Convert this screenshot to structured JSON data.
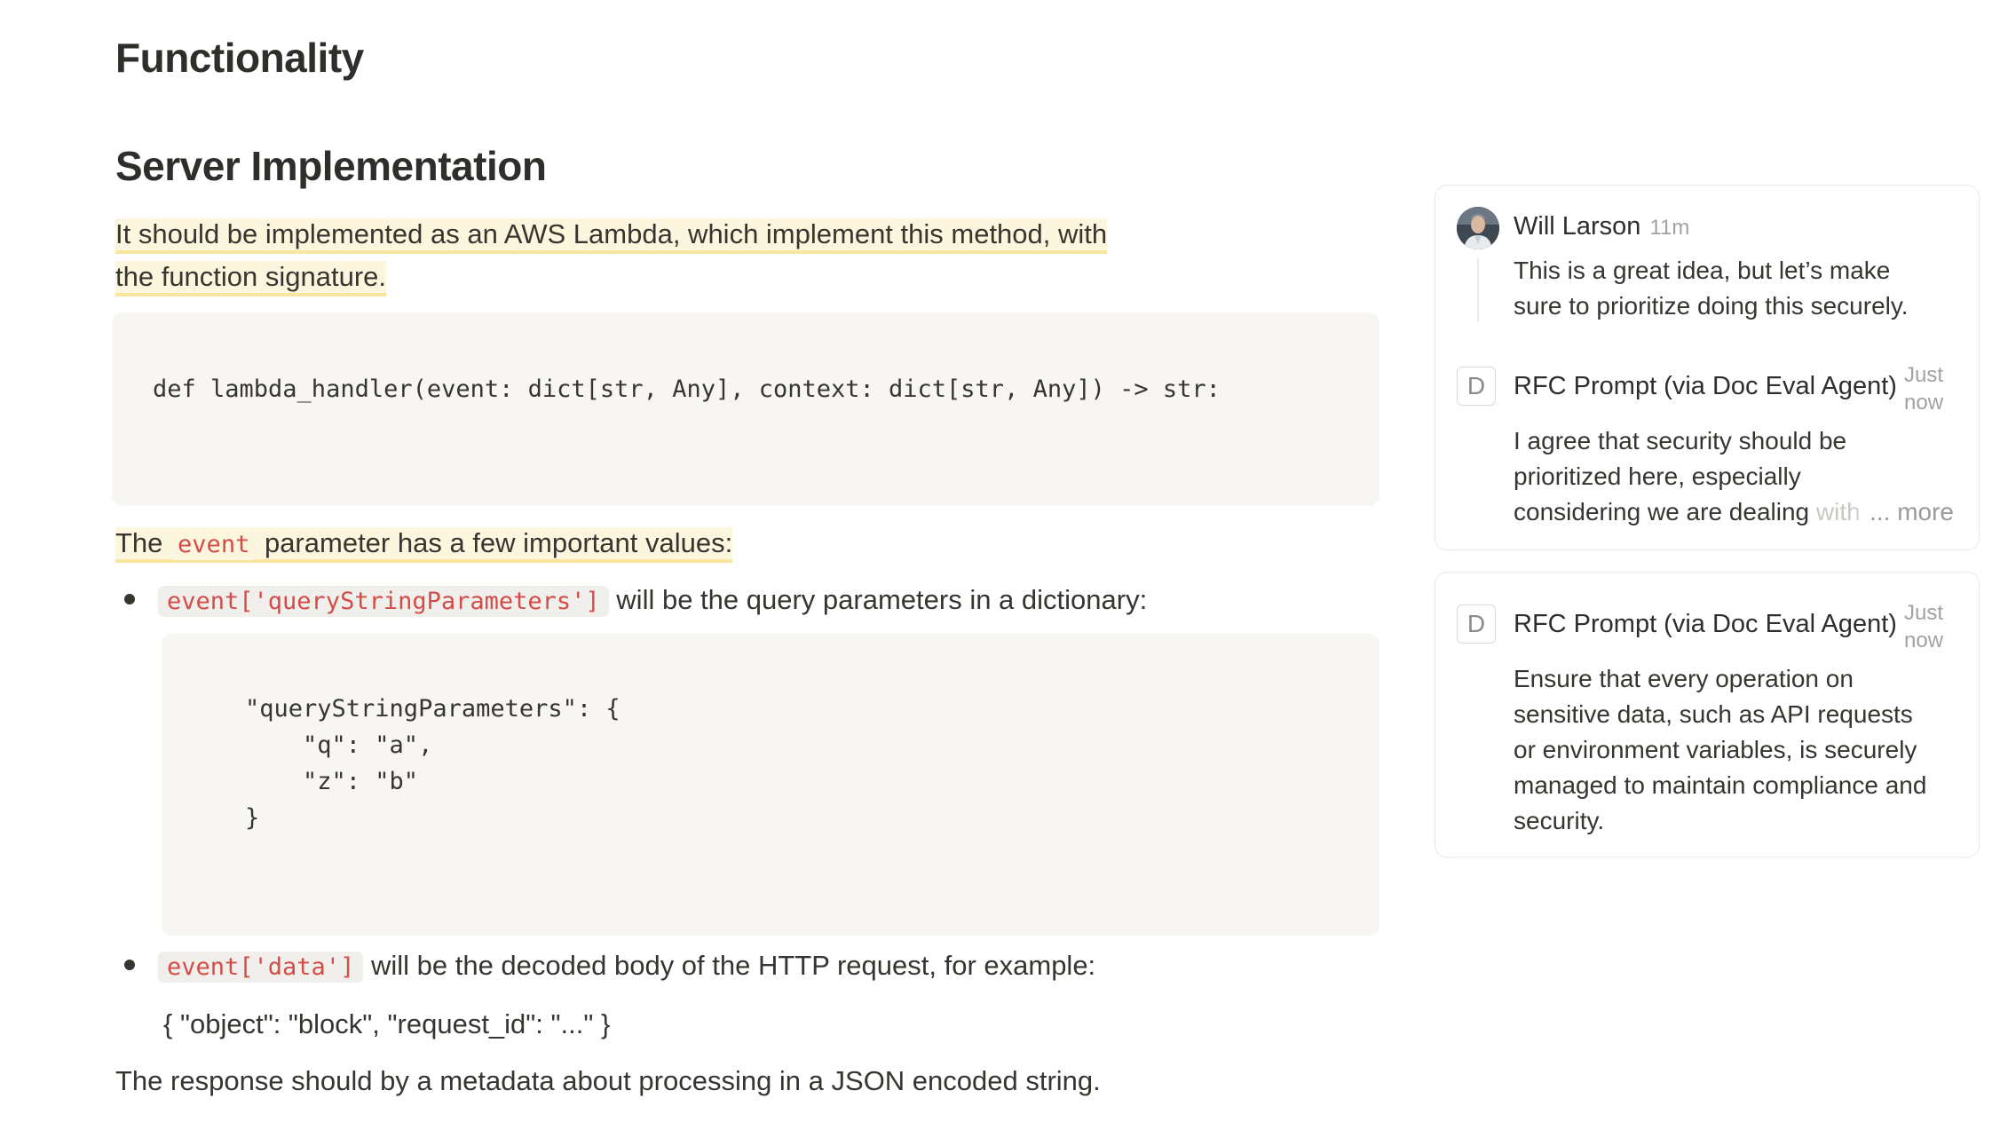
{
  "document": {
    "heading": "Functionality",
    "subheading": "Server Implementation",
    "intro_line1": "It should be implemented as an AWS Lambda, which implement this method, with",
    "intro_line2": "the function signature.",
    "code_signature": "def lambda_handler(event: dict[str, Any], context: dict[str, Any]) -> str:",
    "event_para": {
      "before": "The",
      "code": "event",
      "after": "parameter has a few important values:"
    },
    "bullets": [
      {
        "code": "event['queryStringParameters']",
        "text": "will be the query parameters in a dictionary:"
      },
      {
        "code": "event['data']",
        "text": "will be the decoded body of the HTTP request, for example:"
      }
    ],
    "code_query": "\"queryStringParameters\": {\n    \"q\": \"a\",\n    \"z\": \"b\"\n}",
    "example_body": "{ \"object\": \"block\", \"request_id\": \"...\" }",
    "response_line": "The response should by a metadata about processing in a JSON encoded string."
  },
  "comments": {
    "card1": {
      "first": {
        "author": "Will Larson",
        "time": "11m",
        "avatar": "user-photo-avatar",
        "text_line1": "This is a great idea, but let’s make",
        "text_line2": "sure to prioritize doing this securely."
      },
      "second": {
        "avatar_letter": "D",
        "author": "RFC Prompt (via Doc Eval Agent)",
        "time_line1": "Just",
        "time_line2": "now",
        "text_line1": "I agree that security should be",
        "text_line2": "prioritized here, especially",
        "text_line3": "considering we are dealing",
        "text_line3_faded": " with",
        "more_label": "... more"
      }
    },
    "card2": {
      "avatar_letter": "D",
      "author": "RFC Prompt (via Doc Eval Agent)",
      "time_line1": "Just",
      "time_line2": "now",
      "text_line1": "Ensure that every operation on",
      "text_line2": "sensitive data, such as API requests",
      "text_line3": "or environment variables, is securely",
      "text_line4": "managed to maintain compliance and",
      "text_line5": "security."
    }
  }
}
